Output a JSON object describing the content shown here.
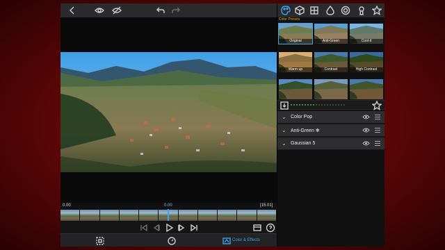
{
  "toolbar": {
    "back_icon": "chevron-left-icon",
    "preview_icon": "eye-icon",
    "compare_icon": "eye-slash-icon",
    "undo_icon": "undo-icon",
    "redo_icon": "redo-icon"
  },
  "right_tabs": [
    {
      "icon": "palette-icon",
      "active": true
    },
    {
      "icon": "cube-icon"
    },
    {
      "icon": "grid-icon"
    },
    {
      "icon": "drop-icon"
    },
    {
      "icon": "spiral-icon"
    },
    {
      "icon": "keyhole-icon"
    },
    {
      "icon": "star-icon"
    }
  ],
  "presets": {
    "section_label": "Color Presets",
    "items": [
      {
        "label": "Original",
        "selected": true
      },
      {
        "label": "Anti-Green"
      },
      {
        "label": "Cool-it"
      },
      {
        "label": "Warm-up"
      },
      {
        "label": "Contrast"
      },
      {
        "label": "High Contrast"
      },
      {
        "label": ""
      },
      {
        "label": ""
      },
      {
        "label": ""
      }
    ]
  },
  "timeline": {
    "start_time": "0.00",
    "current_time": "0.00",
    "end_time": "[15.01]"
  },
  "layers": [
    {
      "name": "Color Pop"
    },
    {
      "name": "Anti-Green ✻"
    },
    {
      "name": "Gaussian 5"
    }
  ],
  "bottom": {
    "effects_label": "Color & Effects"
  },
  "colors": {
    "accent": "#3ea3e8",
    "preset_label": "#d9a51c",
    "level_on": "#35c24a"
  }
}
